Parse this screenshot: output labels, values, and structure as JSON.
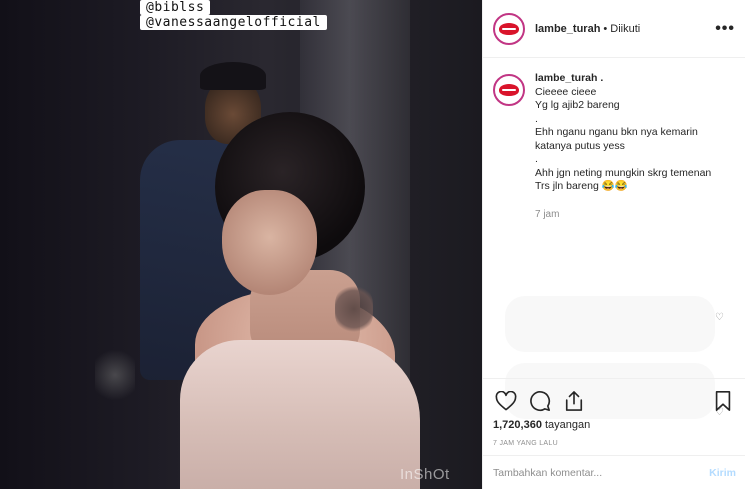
{
  "media": {
    "overlay_tags": [
      "@biblss",
      "@vanessaangelofficial"
    ],
    "watermark": "InShOt"
  },
  "post": {
    "username": "lambe_turah",
    "separator": "•",
    "follow_status": "Diikuti",
    "more_label": "•••"
  },
  "caption": {
    "username": "lambe_turah .",
    "lines": [
      "Cieeee cieee",
      "Yg lg ajib2 bareng",
      ".",
      "Ehh nganu nganu bkn nya kemarin",
      "katanya putus yess",
      ".",
      "Ahh jgn neting mungkin skrg temenan",
      "Trs jln bareng 😂😂"
    ],
    "time": "7 jam"
  },
  "stats": {
    "views_count": "1,720,360",
    "views_label": "tayangan",
    "posted_ago": "7 JAM YANG LALU"
  },
  "comment_input": {
    "placeholder": "Tambahkan komentar...",
    "post_label": "Kirim"
  },
  "icons": {
    "like": "heart-icon",
    "comment": "comment-icon",
    "share": "share-icon",
    "save": "bookmark-icon"
  },
  "colors": {
    "accent_link": "#b3dbff",
    "avatar_ring": "#c13584",
    "brand_lips": "#d9142b"
  }
}
